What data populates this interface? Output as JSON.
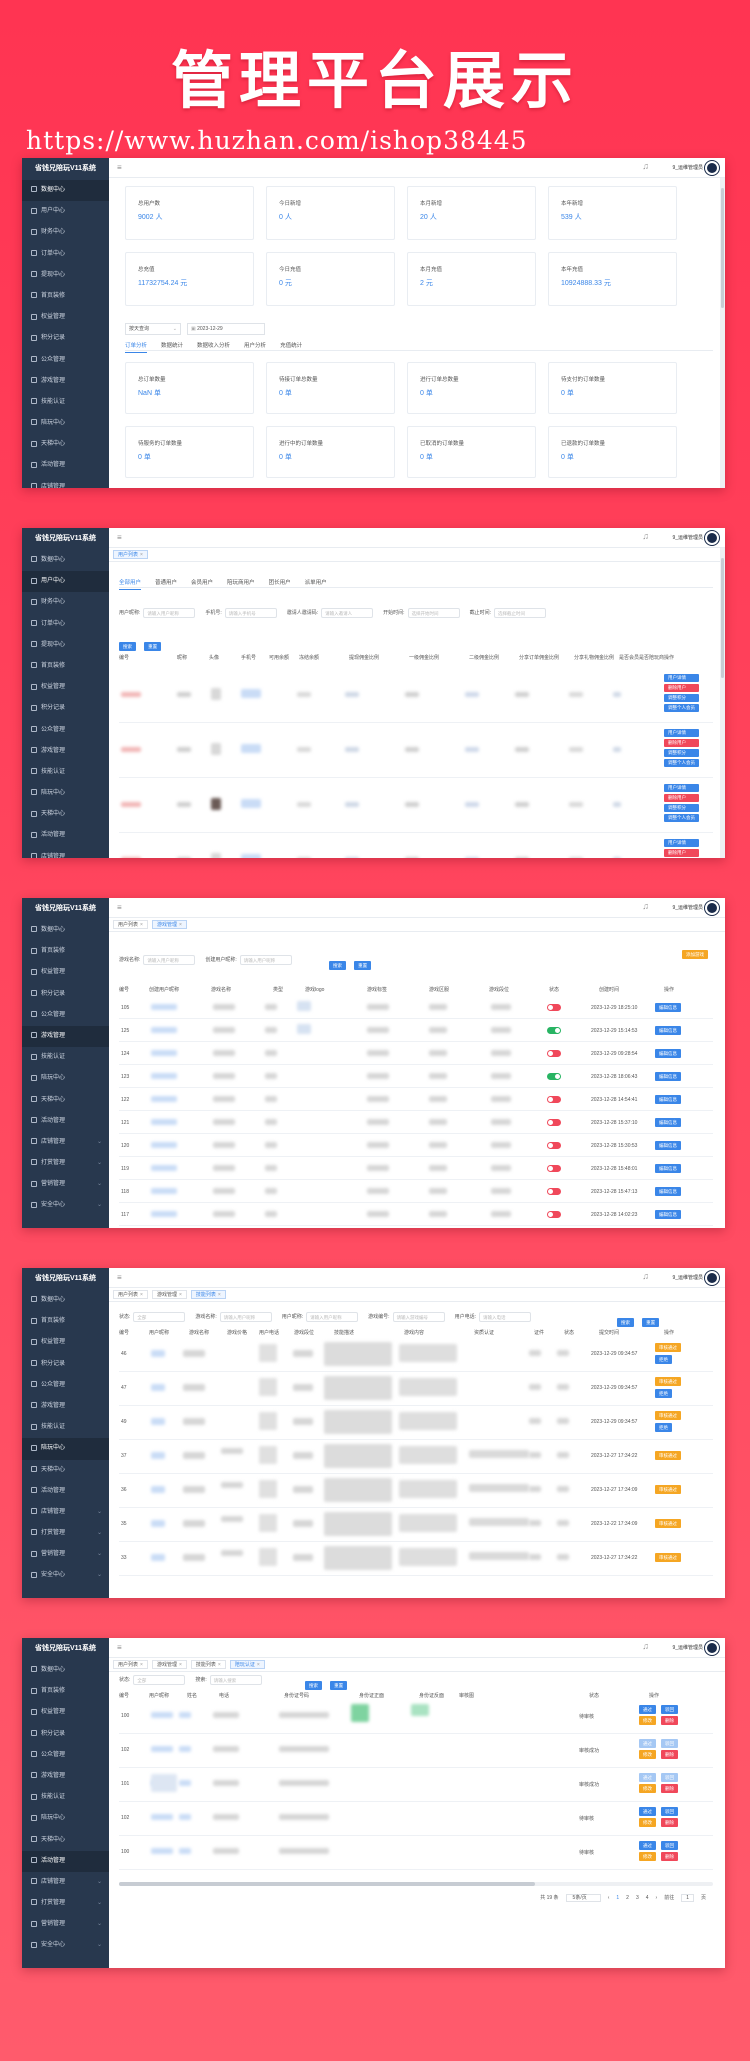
{
  "hero": {
    "title": "管理平台展示",
    "url": "https://www.huzhan.com/ishop38445"
  },
  "app": {
    "name": "省钱兄陪玩V11系统",
    "user": "9_运维管理员",
    "hamburger": "≡",
    "bell": "♫",
    "close": "×"
  },
  "colors": {
    "accent": "#3a86e8",
    "sidebar": "#28384e",
    "danger": "#f0485a",
    "warning": "#f5a623",
    "success": "#28b463",
    "background": "#ff3452"
  },
  "sidebar1": [
    "数据中心",
    "用户中心",
    "财务中心",
    "订单中心",
    "提现中心",
    "首页装修",
    "权益管理",
    "积分记录",
    "公众管理",
    "游戏管理",
    "技能认证",
    "陪玩中心",
    "天梯中心",
    "活动管理",
    "店铺管理"
  ],
  "sidebar2": [
    "数据中心",
    "用户中心",
    "财务中心",
    "订单中心",
    "提现中心",
    "首页装修",
    "权益管理",
    "积分记录",
    "公众管理",
    "游戏管理",
    "技能认证",
    "陪玩中心",
    "天梯中心",
    "活动管理",
    "店铺管理"
  ],
  "sidebar3": [
    "数据中心",
    "首页装修",
    "权益管理",
    "积分记录",
    "公众管理",
    "游戏管理",
    "技能认证",
    "陪玩中心",
    "天梯中心",
    "活动管理",
    "店铺管理",
    "打赏管理",
    "营销管理",
    "安全中心"
  ],
  "sidebar4": [
    "数据中心",
    "首页装修",
    "权益管理",
    "积分记录",
    "公众管理",
    "游戏管理",
    "技能认证",
    "陪玩中心",
    "天梯中心",
    "活动管理",
    "店铺管理",
    "打赏管理",
    "营销管理",
    "安全中心"
  ],
  "sidebar5": [
    "数据中心",
    "首页装修",
    "权益管理",
    "积分记录",
    "公众管理",
    "游戏管理",
    "技能认证",
    "陪玩中心",
    "天梯中心",
    "活动管理",
    "店铺管理",
    "打赏管理",
    "营销管理",
    "安全中心"
  ],
  "panel1": {
    "stats_top": [
      {
        "label": "总用户数",
        "value": "9002 人"
      },
      {
        "label": "今日新增",
        "value": "0 人"
      },
      {
        "label": "本月新增",
        "value": "20 人"
      },
      {
        "label": "本年新增",
        "value": "539 人"
      },
      {
        "label": "总充值",
        "value": "11732754.24 元"
      },
      {
        "label": "今日充值",
        "value": "0 元"
      },
      {
        "label": "本月充值",
        "value": "2 元"
      },
      {
        "label": "本年充值",
        "value": "10924888.33 元"
      }
    ],
    "select_value": "按天查询",
    "date_value": "2023-12-29",
    "tabs": [
      "订单分析",
      "数据统计",
      "数据收入分析",
      "用户分析",
      "充值统计"
    ],
    "stats_orders": [
      {
        "label": "总订单数量",
        "value": "NaN 单"
      },
      {
        "label": "待接订单总数量",
        "value": "0 单"
      },
      {
        "label": "进行订单总数量",
        "value": "0 单"
      },
      {
        "label": "待支付的订单数量",
        "value": "0 单"
      },
      {
        "label": "待服务的订单数量",
        "value": "0 单"
      },
      {
        "label": "进行中的订单数量",
        "value": "0 单"
      },
      {
        "label": "已取消的订单数量",
        "value": "0 单"
      },
      {
        "label": "已退款的订单数量",
        "value": "0 单"
      }
    ]
  },
  "panel2": {
    "tag": "用户列表",
    "subtabs": [
      "全部用户",
      "普通用户",
      "会员用户",
      "陪玩商用户",
      "团长用户",
      "派单用户"
    ],
    "filters": [
      {
        "label": "用户昵称:",
        "placeholder": "请输入用户昵称"
      },
      {
        "label": "手机号:",
        "placeholder": "请输入手机号"
      },
      {
        "label": "邀请人邀请码:",
        "placeholder": "请输入邀请人"
      },
      {
        "label": "开始时间:",
        "placeholder": "选择开始时间"
      },
      {
        "label": "截止时间:",
        "placeholder": "选择截止时间"
      }
    ],
    "search": "搜索",
    "reset": "重置",
    "columns": [
      "编号",
      "昵称",
      "头像",
      "手机号",
      "可用余额",
      "冻结余额",
      "提现佣金比例",
      "一级佣金比例",
      "二级佣金比例",
      "分享订单佣金比例",
      "分享礼物佣金比例",
      "是否会员",
      "是否陪玩商",
      "操作"
    ],
    "actions": [
      "用户详情",
      "删除用户",
      "调整积分",
      "调整个人会员"
    ]
  },
  "panel3": {
    "tags": [
      "用户列表",
      "游戏管理"
    ],
    "filters": [
      {
        "label": "游戏名称:",
        "placeholder": "请输入用户昵称"
      },
      {
        "label": "创建用户昵称:",
        "placeholder": "请输入用户昵称"
      }
    ],
    "search": "搜索",
    "reset": "重置",
    "add": "添加游戏",
    "columns": [
      "编号",
      "创建用户昵称",
      "游戏名称",
      "类型",
      "游戏logo",
      "游戏标签",
      "游戏区服",
      "游戏段位",
      "状态",
      "创建时间",
      "操作"
    ],
    "rows": [
      {
        "id": "105",
        "time": "2023-12-29 18:25:10",
        "on": false
      },
      {
        "id": "125",
        "time": "2023-12-29 15:14:53",
        "on": true
      },
      {
        "id": "124",
        "time": "2023-12-29 09:28:54",
        "on": false
      },
      {
        "id": "123",
        "time": "2023-12-28 18:06:43",
        "on": true
      },
      {
        "id": "122",
        "time": "2023-12-28 14:54:41",
        "on": false
      },
      {
        "id": "121",
        "time": "2023-12-28 15:37:10",
        "on": false
      },
      {
        "id": "120",
        "time": "2023-12-28 15:30:53",
        "on": false
      },
      {
        "id": "119",
        "time": "2023-12-28 15:48:01",
        "on": false
      },
      {
        "id": "118",
        "time": "2023-12-28 15:47:13",
        "on": false
      },
      {
        "id": "117",
        "time": "2023-12-28 14:02:23",
        "on": false
      }
    ],
    "edit": "编辑信息"
  },
  "panel4": {
    "tags": [
      "用户列表",
      "游戏管理",
      "技能列表"
    ],
    "filters": [
      {
        "label": "状态:",
        "placeholder": "全部"
      },
      {
        "label": "游戏名称:",
        "placeholder": "请输入用户昵称"
      },
      {
        "label": "用户昵称:",
        "placeholder": "请输入用户昵称"
      },
      {
        "label": "游戏编号:",
        "placeholder": "请输入游戏编号"
      },
      {
        "label": "用户电话:",
        "placeholder": "请输入电话"
      }
    ],
    "search": "搜索",
    "reset": "重置",
    "columns": [
      "编号",
      "用户昵称",
      "游戏名称",
      "游戏价格",
      "用户电话",
      "游戏段位",
      "技能描述",
      "游戏内容",
      "资质认证",
      "证件",
      "状态",
      "提交时间",
      "操作"
    ],
    "rows": [
      {
        "id": "46",
        "time": "2023-12-29 09:34:57"
      },
      {
        "id": "47",
        "time": "2023-12-29 09:34:57"
      },
      {
        "id": "49",
        "time": "2023-12-29 09:34:57"
      },
      {
        "id": "37",
        "time": "2023-12-27 17:34:22"
      },
      {
        "id": "36",
        "time": "2023-12-27 17:34:09"
      },
      {
        "id": "35",
        "time": "2023-12-22 17:34:09"
      },
      {
        "id": "33",
        "time": "2023-12-27 17:34:22"
      }
    ],
    "approve": "审核通过",
    "reject": "拒绝"
  },
  "panel5": {
    "tags": [
      "用户列表",
      "游戏管理",
      "技能列表",
      "陪玩认证"
    ],
    "filters": [
      {
        "label": "状态:",
        "placeholder": "全部"
      },
      {
        "label": "搜索:",
        "placeholder": "请输入搜索"
      }
    ],
    "search": "搜索",
    "reset": "重置",
    "columns": [
      "编号",
      "用户昵称",
      "姓名",
      "电话",
      "身份证号码",
      "身份证正面",
      "身份证反面",
      "审核图",
      "状态",
      "操作"
    ],
    "rows": [
      {
        "id": "100",
        "status": "待审核"
      },
      {
        "id": "102",
        "status": "审核成功"
      },
      {
        "id": "101",
        "status": "审核成功"
      },
      {
        "id": "102",
        "status": "待审核"
      },
      {
        "id": "100",
        "status": "待审核"
      }
    ],
    "ops": [
      "通过",
      "驳回",
      "修改",
      "删除"
    ],
    "pager": {
      "total": "共 19 条",
      "size": "5条/页",
      "pages": [
        "1",
        "2",
        "3",
        "4"
      ],
      "goto": "前往",
      "page": "1",
      "unit": "页",
      "prev": "‹",
      "next": "›"
    }
  }
}
